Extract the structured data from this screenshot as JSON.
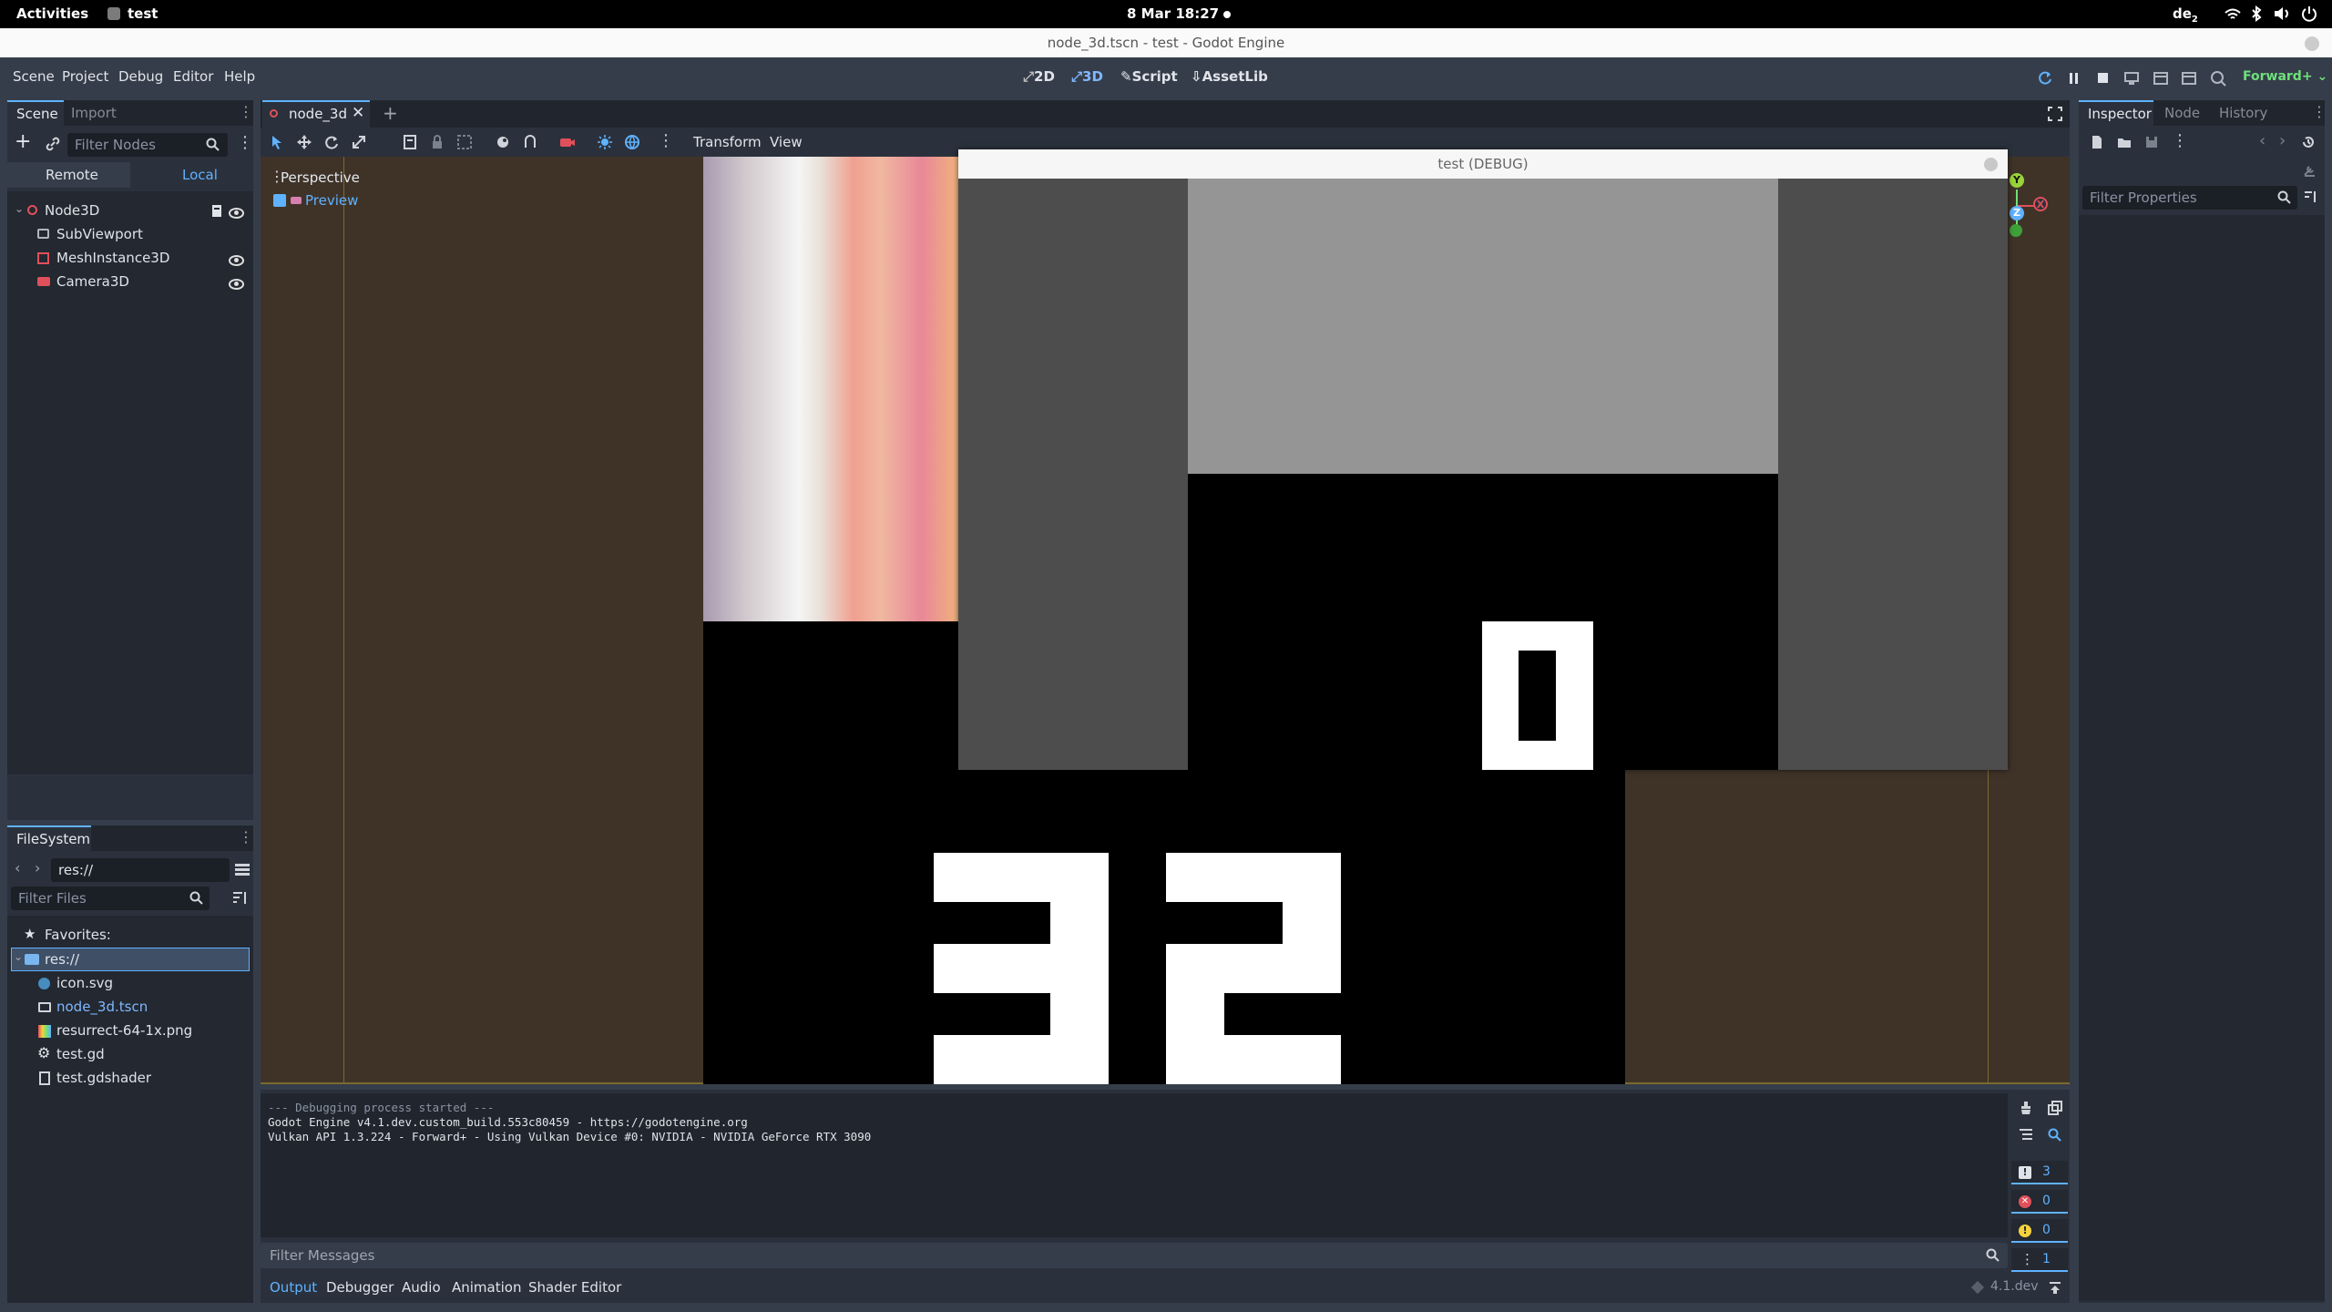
{
  "gnome": {
    "activities": "Activities",
    "app": "test",
    "clock": "8 Mar  18:27",
    "keyboard": "de",
    "keyboard_sub": "2"
  },
  "window": {
    "title": "node_3d.tscn - test - Godot Engine"
  },
  "menu": [
    "Scene",
    "Project",
    "Debug",
    "Editor",
    "Help"
  ],
  "workspaces": [
    "2D",
    "3D",
    "Script",
    "AssetLib"
  ],
  "renderer": "Forward+",
  "scene_dock": {
    "tabs": [
      "Scene",
      "Import"
    ],
    "filter_placeholder": "Filter Nodes",
    "remote": "Remote",
    "local": "Local",
    "nodes": [
      "Node3D",
      "SubViewport",
      "MeshInstance3D",
      "Camera3D"
    ]
  },
  "filesystem": {
    "title": "FileSystem",
    "path": "res://",
    "filter_placeholder": "Filter Files",
    "favorites": "Favorites:",
    "root": "res://",
    "files": [
      "icon.svg",
      "node_3d.tscn",
      "resurrect-64-1x.png",
      "test.gd",
      "test.gdshader"
    ]
  },
  "editor_tab": "node_3d",
  "toolbar": {
    "transform": "Transform",
    "view": "View"
  },
  "viewport": {
    "perspective": "Perspective",
    "preview": "Preview"
  },
  "gizmo": {
    "y": "Y",
    "x": "X",
    "z": "Z"
  },
  "score": {
    "left": "3",
    "right": "2"
  },
  "debug_window": {
    "title": "test (DEBUG)",
    "digit": "0"
  },
  "inspector": {
    "tabs": [
      "Inspector",
      "Node",
      "History"
    ],
    "filter_placeholder": "Filter Properties"
  },
  "output": {
    "lines": [
      "--- Debugging process started ---",
      "Godot Engine v4.1.dev.custom_build.553c80459 - https://godotengine.org",
      "Vulkan API 1.3.224 - Forward+ - Using Vulkan Device #0: NVIDIA - NVIDIA GeForce RTX 3090"
    ],
    "counts": [
      "3",
      "0",
      "0",
      "1"
    ],
    "filter_placeholder": "Filter Messages"
  },
  "bottom_tabs": [
    "Output",
    "Debugger",
    "Audio",
    "Animation",
    "Shader Editor"
  ],
  "version": "4.1.dev",
  "colors": {
    "accent": "#5fb2ff",
    "viewport_bg": "#3f3328",
    "error": "#e0505a",
    "warning": "#f5d23d"
  }
}
